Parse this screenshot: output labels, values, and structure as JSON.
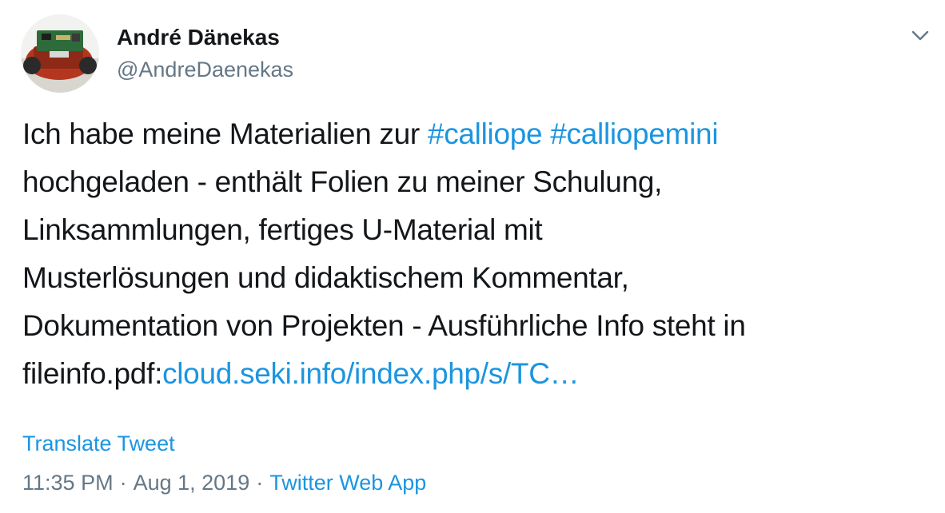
{
  "author": {
    "name": "André Dänekas",
    "handle": "@AndreDaenekas"
  },
  "tweet": {
    "line1_text": "Ich habe meine Materialien zur ",
    "hashtag1": "#calliope",
    "hashtag2": "#calliopemini",
    "line2": "hochgeladen - enthält Folien zu meiner Schulung,",
    "line3": "Linksammlungen, fertiges U-Material mit",
    "line4": "Musterlösungen und didaktischem Kommentar,",
    "line5": "Dokumentation von Projekten - Ausführliche Info steht in",
    "line6_text": "fileinfo.pdf:",
    "link": "cloud.seki.info/index.php/s/TC…"
  },
  "translate_label": "Translate Tweet",
  "meta": {
    "time": "11:35 PM",
    "separator": "·",
    "date": "Aug 1, 2019",
    "source": "Twitter Web App"
  },
  "icons": {
    "caret": "chevron-down-icon",
    "avatar": "avatar-image"
  },
  "colors": {
    "link": "#1b95e0",
    "text": "#14171a",
    "muted": "#657786"
  }
}
